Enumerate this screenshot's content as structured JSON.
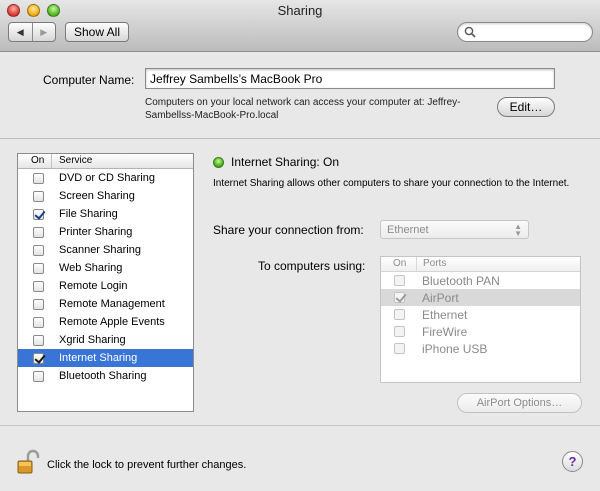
{
  "window": {
    "title": "Sharing"
  },
  "toolbar": {
    "back_glyph": "◀",
    "forward_glyph": "▶",
    "show_all_label": "Show All",
    "search_value": "",
    "search_icon": "magnifier-icon"
  },
  "computer_name": {
    "label": "Computer Name:",
    "value": "Jeffrey Sambells’s MacBook Pro",
    "description": "Computers on your local network can access your computer at: Jeffrey-Sambellss-MacBook-Pro.local",
    "edit_label": "Edit…"
  },
  "services": {
    "col_on": "On",
    "col_service": "Service",
    "items": [
      {
        "label": "DVD or CD Sharing",
        "on": false,
        "selected": false
      },
      {
        "label": "Screen Sharing",
        "on": false,
        "selected": false
      },
      {
        "label": "File Sharing",
        "on": true,
        "selected": false
      },
      {
        "label": "Printer Sharing",
        "on": false,
        "selected": false
      },
      {
        "label": "Scanner Sharing",
        "on": false,
        "selected": false
      },
      {
        "label": "Web Sharing",
        "on": false,
        "selected": false
      },
      {
        "label": "Remote Login",
        "on": false,
        "selected": false
      },
      {
        "label": "Remote Management",
        "on": false,
        "selected": false
      },
      {
        "label": "Remote Apple Events",
        "on": false,
        "selected": false
      },
      {
        "label": "Xgrid Sharing",
        "on": false,
        "selected": false
      },
      {
        "label": "Internet Sharing",
        "on": true,
        "selected": true
      },
      {
        "label": "Bluetooth Sharing",
        "on": false,
        "selected": false
      }
    ]
  },
  "detail": {
    "status_text": "Internet Sharing: On",
    "status_color": "#4fb81c",
    "description": "Internet Sharing allows other computers to share your connection to the Internet.",
    "share_from_label": "Share your connection from:",
    "share_from_value": "Ethernet",
    "to_computers_label": "To computers using:",
    "ports_col_on": "On",
    "ports_col_ports": "Ports",
    "ports": [
      {
        "label": "Bluetooth PAN",
        "on": false,
        "selected": false
      },
      {
        "label": "AirPort",
        "on": true,
        "selected": true
      },
      {
        "label": "Ethernet",
        "on": false,
        "selected": false
      },
      {
        "label": "FireWire",
        "on": false,
        "selected": false
      },
      {
        "label": "iPhone USB",
        "on": false,
        "selected": false
      }
    ],
    "airport_options_label": "AirPort Options…"
  },
  "footer": {
    "lock_text": "Click the lock to prevent further changes.",
    "lock_icon": "unlocked-padlock-icon",
    "help_label": "?"
  },
  "colors": {
    "selection": "#3875d7",
    "window_bg": "#e8e8e8"
  }
}
